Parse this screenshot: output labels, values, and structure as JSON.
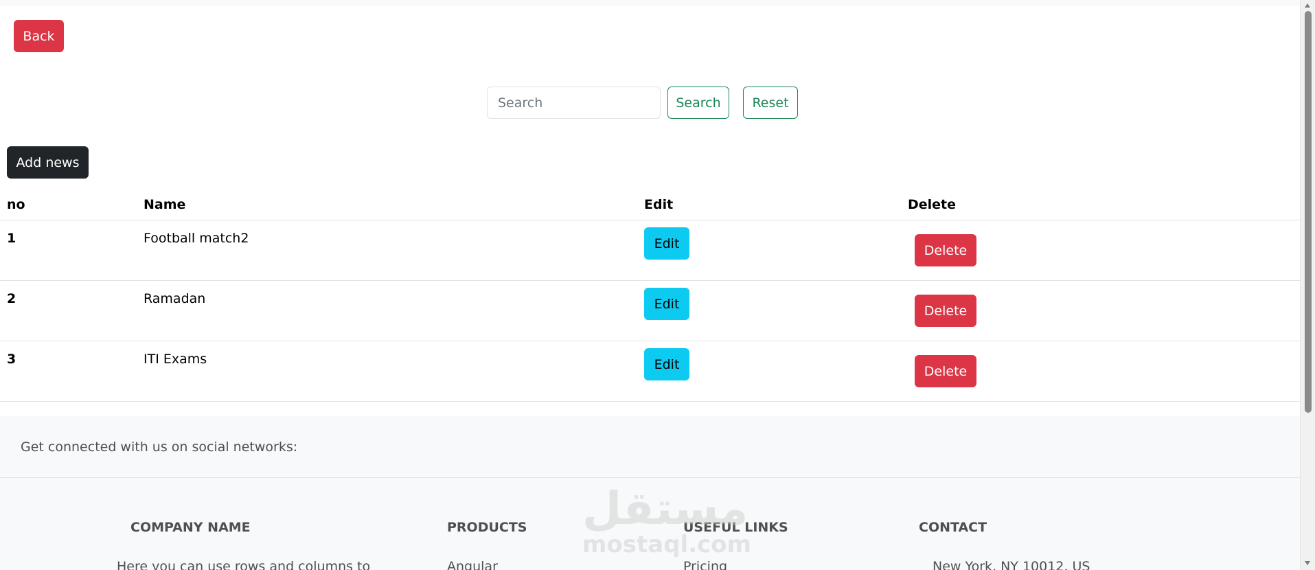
{
  "toolbar": {
    "back_label": "Back",
    "search_placeholder": "Search",
    "search_value": "",
    "search_label": "Search",
    "reset_label": "Reset",
    "add_label": "Add news"
  },
  "table": {
    "columns": [
      "no",
      "Name",
      "Edit",
      "Delete"
    ],
    "rows": [
      {
        "no": "1",
        "name": "Football match2",
        "edit": "Edit",
        "delete": "Delete"
      },
      {
        "no": "2",
        "name": "Ramadan",
        "edit": "Edit",
        "delete": "Delete"
      },
      {
        "no": "3",
        "name": "ITI Exams",
        "edit": "Edit",
        "delete": "Delete"
      }
    ]
  },
  "footer": {
    "social_text": "Get connected with us on social networks:",
    "columns": [
      {
        "heading": "COMPANY NAME",
        "first_line": "Here you can use rows and columns to"
      },
      {
        "heading": "PRODUCTS",
        "first_line": "Angular"
      },
      {
        "heading": "USEFUL LINKS",
        "first_line": "Pricing"
      },
      {
        "heading": "CONTACT",
        "first_line": "New York, NY 10012, US"
      }
    ]
  },
  "watermark": {
    "arabic": "مستقل",
    "latin": "mostaql.com"
  },
  "colors": {
    "danger": "#dc3545",
    "success": "#198754",
    "dark": "#212529",
    "info": "#0dcaf0",
    "footer_bg": "#f8f9fa"
  },
  "icons": {
    "scroll_up": "triangle-up-icon",
    "scroll_down": "triangle-down-icon"
  }
}
